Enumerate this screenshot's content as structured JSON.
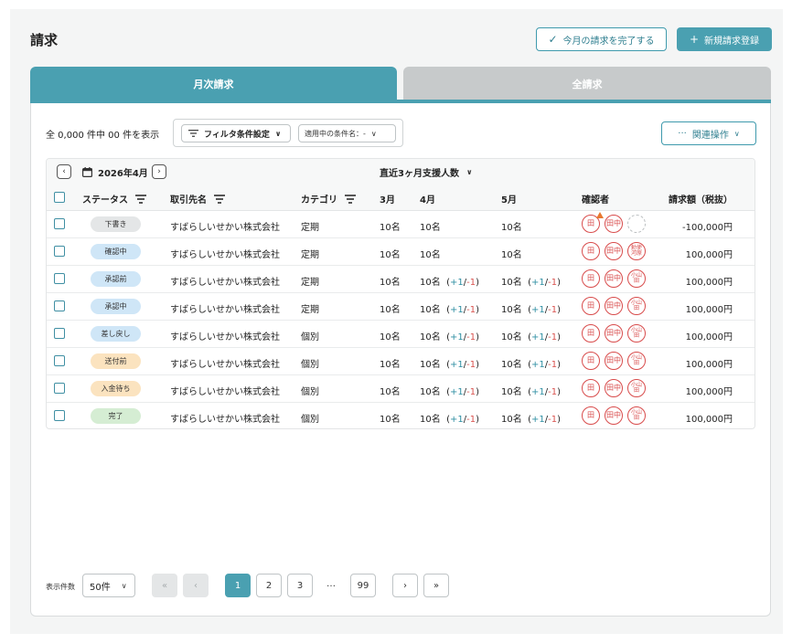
{
  "page": {
    "title": "請求"
  },
  "header": {
    "complete_button": "今月の請求を完了する",
    "new_button": "新規請求登録"
  },
  "tabs": [
    {
      "label": "月次請求",
      "active": true
    },
    {
      "label": "全請求",
      "active": false
    }
  ],
  "toolbar": {
    "count_text": "全 0,000 件中  00 件を表示",
    "filter_label": "フィルタ条件設定",
    "condition_label": "適用中の条件名：-",
    "related_label": "関連操作"
  },
  "month_nav": {
    "month": "2026年4月",
    "support_label": "直近3ヶ月支援人数"
  },
  "columns": {
    "status": "ステータス",
    "client": "取引先名",
    "category": "カテゴリ",
    "m3": "3月",
    "m4": "4月",
    "m5": "5月",
    "approver": "確認者",
    "amount": "請求額（税抜）"
  },
  "rows": [
    {
      "status": "下書き",
      "status_color": "#e4e6e7",
      "client": "すばらしいせかい株式会社",
      "category": "定期",
      "m3": "10名",
      "m4": "10名",
      "m4_plus": "",
      "m4_minus": "",
      "m5": "10名",
      "m5_plus": "",
      "m5_minus": "",
      "stamps": [
        "田",
        "田中",
        ""
      ],
      "warn": true,
      "amount": "-100,000円"
    },
    {
      "status": "確認中",
      "status_color": "#cfe6f7",
      "client": "すばらしいせかい株式会社",
      "category": "定期",
      "m3": "10名",
      "m4": "10名",
      "m4_plus": "",
      "m4_minus": "",
      "m5": "10名",
      "m5_plus": "",
      "m5_minus": "",
      "stamps": [
        "田",
        "田中",
        "勅使河原"
      ],
      "warn": false,
      "amount": "100,000円"
    },
    {
      "status": "承認前",
      "status_color": "#cfe6f7",
      "client": "すばらしいせかい株式会社",
      "category": "定期",
      "m3": "10名",
      "m4": "10名",
      "m4_plus": "+1",
      "m4_minus": "-1",
      "m5": "10名",
      "m5_plus": "+1",
      "m5_minus": "-1",
      "stamps": [
        "田",
        "田中",
        "小山田"
      ],
      "warn": false,
      "amount": "100,000円"
    },
    {
      "status": "承認中",
      "status_color": "#cfe6f7",
      "client": "すばらしいせかい株式会社",
      "category": "定期",
      "m3": "10名",
      "m4": "10名",
      "m4_plus": "+1",
      "m4_minus": "-1",
      "m5": "10名",
      "m5_plus": "+1",
      "m5_minus": "-1",
      "stamps": [
        "田",
        "田中",
        "小山田"
      ],
      "warn": false,
      "amount": "100,000円"
    },
    {
      "status": "差し戻し",
      "status_color": "#cfe6f7",
      "client": "すばらしいせかい株式会社",
      "category": "個別",
      "m3": "10名",
      "m4": "10名",
      "m4_plus": "+1",
      "m4_minus": "-1",
      "m5": "10名",
      "m5_plus": "+1",
      "m5_minus": "-1",
      "stamps": [
        "田",
        "田中",
        "小山田"
      ],
      "warn": false,
      "amount": "100,000円"
    },
    {
      "status": "送付前",
      "status_color": "#fbe3bf",
      "client": "すばらしいせかい株式会社",
      "category": "個別",
      "m3": "10名",
      "m4": "10名",
      "m4_plus": "+1",
      "m4_minus": "-1",
      "m5": "10名",
      "m5_plus": "+1",
      "m5_minus": "-1",
      "stamps": [
        "田",
        "田中",
        "小山田"
      ],
      "warn": false,
      "amount": "100,000円"
    },
    {
      "status": "入金待ち",
      "status_color": "#fbe3bf",
      "client": "すばらしいせかい株式会社",
      "category": "個別",
      "m3": "10名",
      "m4": "10名",
      "m4_plus": "+1",
      "m4_minus": "-1",
      "m5": "10名",
      "m5_plus": "+1",
      "m5_minus": "-1",
      "stamps": [
        "田",
        "田中",
        "小山田"
      ],
      "warn": false,
      "amount": "100,000円"
    },
    {
      "status": "完了",
      "status_color": "#d5edd3",
      "client": "すばらしいせかい株式会社",
      "category": "個別",
      "m3": "10名",
      "m4": "10名",
      "m4_plus": "+1",
      "m4_minus": "-1",
      "m5": "10名",
      "m5_plus": "+1",
      "m5_minus": "-1",
      "stamps": [
        "田",
        "田中",
        "小山田"
      ],
      "warn": false,
      "amount": "100,000円"
    }
  ],
  "pagination": {
    "per_page_label": "表示件数",
    "per_page_value": "50件",
    "pages": [
      "1",
      "2",
      "3"
    ],
    "ellipsis": "…",
    "last": "99",
    "current": "1"
  }
}
